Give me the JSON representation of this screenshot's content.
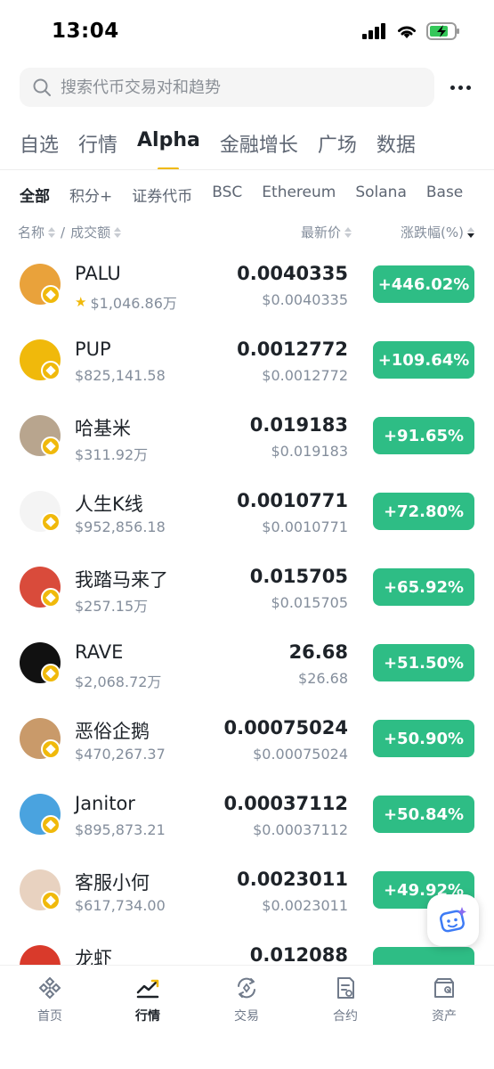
{
  "status_bar": {
    "time": "13:04"
  },
  "search": {
    "placeholder": "搜索代币交易对和趋势"
  },
  "main_tabs": [
    {
      "label": "自选",
      "active": false
    },
    {
      "label": "行情",
      "active": false
    },
    {
      "label": "Alpha",
      "active": true
    },
    {
      "label": "金融增长",
      "active": false
    },
    {
      "label": "广场",
      "active": false
    },
    {
      "label": "数据",
      "active": false
    }
  ],
  "sub_tabs": [
    {
      "label": "全部",
      "active": true
    },
    {
      "label": "积分+",
      "active": false
    },
    {
      "label": "证券代币",
      "active": false
    },
    {
      "label": "BSC",
      "active": false
    },
    {
      "label": "Ethereum",
      "active": false
    },
    {
      "label": "Solana",
      "active": false
    },
    {
      "label": "Base",
      "active": false
    }
  ],
  "columns": {
    "name": "名称",
    "separator": "/",
    "volume": "成交额",
    "price": "最新价",
    "change": "涨跌幅(%)"
  },
  "tokens": [
    {
      "name": "PALU",
      "volume": "$1,046.86万",
      "starred": true,
      "price": "0.0040335",
      "price_usd": "$0.0040335",
      "change": "+446.02%",
      "avatar_color": "#e9a23b"
    },
    {
      "name": "PUP",
      "volume": "$825,141.58",
      "starred": false,
      "price": "0.0012772",
      "price_usd": "$0.0012772",
      "change": "+109.64%",
      "avatar_color": "#f0b90b"
    },
    {
      "name": "哈基米",
      "volume": "$311.92万",
      "starred": false,
      "price": "0.019183",
      "price_usd": "$0.019183",
      "change": "+91.65%",
      "avatar_color": "#b8a58e"
    },
    {
      "name": "人生K线",
      "volume": "$952,856.18",
      "starred": false,
      "price": "0.0010771",
      "price_usd": "$0.0010771",
      "change": "+72.80%",
      "avatar_color": "#f4f4f4"
    },
    {
      "name": "我踏马来了",
      "volume": "$257.15万",
      "starred": false,
      "price": "0.015705",
      "price_usd": "$0.015705",
      "change": "+65.92%",
      "avatar_color": "#d94b3b"
    },
    {
      "name": "RAVE",
      "volume": "$2,068.72万",
      "starred": false,
      "price": "26.68",
      "price_usd": "$26.68",
      "change": "+51.50%",
      "avatar_color": "#111111"
    },
    {
      "name": "恶俗企鹅",
      "volume": "$470,267.37",
      "starred": false,
      "price": "0.00075024",
      "price_usd": "$0.00075024",
      "change": "+50.90%",
      "avatar_color": "#c99a6a"
    },
    {
      "name": "Janitor",
      "volume": "$895,873.21",
      "starred": false,
      "price": "0.00037112",
      "price_usd": "$0.00037112",
      "change": "+50.84%",
      "avatar_color": "#4aa3df"
    },
    {
      "name": "客服小何",
      "volume": "$617,734.00",
      "starred": false,
      "price": "0.0023011",
      "price_usd": "$0.0023011",
      "change": "+49.92%",
      "avatar_color": "#e8d2c0"
    },
    {
      "name": "龙虾",
      "volume": "",
      "starred": false,
      "price": "0.012088",
      "price_usd": "",
      "change": "",
      "avatar_color": "#d93a2b"
    }
  ],
  "bottom_nav": [
    {
      "label": "首页",
      "icon": "binance-logo-icon",
      "active": false
    },
    {
      "label": "行情",
      "icon": "market-chart-icon",
      "active": true
    },
    {
      "label": "交易",
      "icon": "trade-swap-icon",
      "active": false
    },
    {
      "label": "合约",
      "icon": "futures-doc-icon",
      "active": false
    },
    {
      "label": "资产",
      "icon": "wallet-icon",
      "active": false
    }
  ],
  "colors": {
    "accent": "#f0b90b",
    "up": "#2ebd85",
    "text_primary": "#1e2329",
    "text_secondary": "#848e9c"
  }
}
